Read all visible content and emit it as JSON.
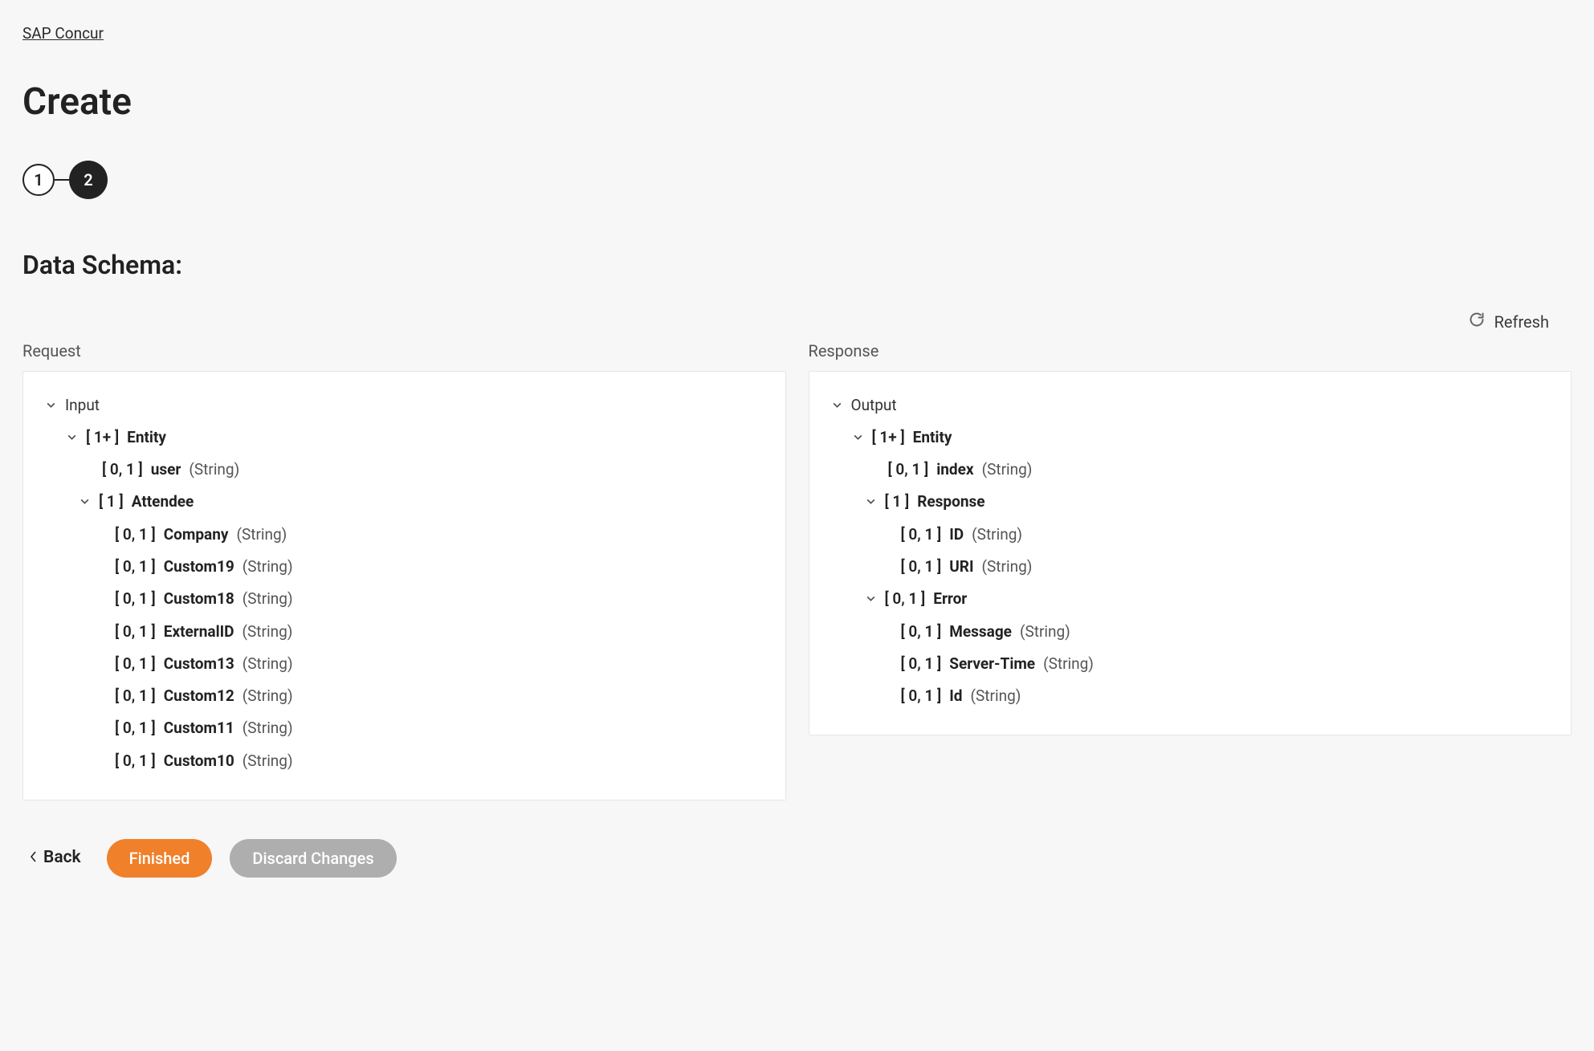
{
  "breadcrumb": "SAP Concur",
  "title": "Create",
  "stepper": {
    "step1": "1",
    "step2": "2"
  },
  "sectionHeading": "Data Schema:",
  "refresh": "Refresh",
  "columns": {
    "request": {
      "label": "Request",
      "root": "Input"
    },
    "response": {
      "label": "Response",
      "root": "Output"
    }
  },
  "requestTree": [
    {
      "depth": 1,
      "card": "[ 1+ ]",
      "name": "Entity",
      "chevron": true
    },
    {
      "depth": 2,
      "card": "[ 0, 1 ]",
      "name": "user",
      "type": "(String)"
    },
    {
      "depth": 2,
      "card": "[ 1 ]",
      "name": "Attendee",
      "chevron": true
    },
    {
      "depth": 3,
      "card": "[ 0, 1 ]",
      "name": "Company",
      "type": "(String)"
    },
    {
      "depth": 3,
      "card": "[ 0, 1 ]",
      "name": "Custom19",
      "type": "(String)"
    },
    {
      "depth": 3,
      "card": "[ 0, 1 ]",
      "name": "Custom18",
      "type": "(String)"
    },
    {
      "depth": 3,
      "card": "[ 0, 1 ]",
      "name": "ExternalID",
      "type": "(String)"
    },
    {
      "depth": 3,
      "card": "[ 0, 1 ]",
      "name": "Custom13",
      "type": "(String)"
    },
    {
      "depth": 3,
      "card": "[ 0, 1 ]",
      "name": "Custom12",
      "type": "(String)"
    },
    {
      "depth": 3,
      "card": "[ 0, 1 ]",
      "name": "Custom11",
      "type": "(String)"
    },
    {
      "depth": 3,
      "card": "[ 0, 1 ]",
      "name": "Custom10",
      "type": "(String)"
    }
  ],
  "responseTree": [
    {
      "depth": 1,
      "card": "[ 1+ ]",
      "name": "Entity",
      "chevron": true
    },
    {
      "depth": 2,
      "card": "[ 0, 1 ]",
      "name": "index",
      "type": "(String)"
    },
    {
      "depth": 2,
      "card": "[ 1 ]",
      "name": "Response",
      "chevron": true
    },
    {
      "depth": 3,
      "card": "[ 0, 1 ]",
      "name": "ID",
      "type": "(String)"
    },
    {
      "depth": 3,
      "card": "[ 0, 1 ]",
      "name": "URI",
      "type": "(String)"
    },
    {
      "depth": 2,
      "card": "[ 0, 1 ]",
      "name": "Error",
      "chevron": true
    },
    {
      "depth": 3,
      "card": "[ 0, 1 ]",
      "name": "Message",
      "type": "(String)"
    },
    {
      "depth": 3,
      "card": "[ 0, 1 ]",
      "name": "Server-Time",
      "type": "(String)"
    },
    {
      "depth": 3,
      "card": "[ 0, 1 ]",
      "name": "Id",
      "type": "(String)"
    }
  ],
  "footer": {
    "back": "Back",
    "finished": "Finished",
    "discard": "Discard Changes"
  }
}
